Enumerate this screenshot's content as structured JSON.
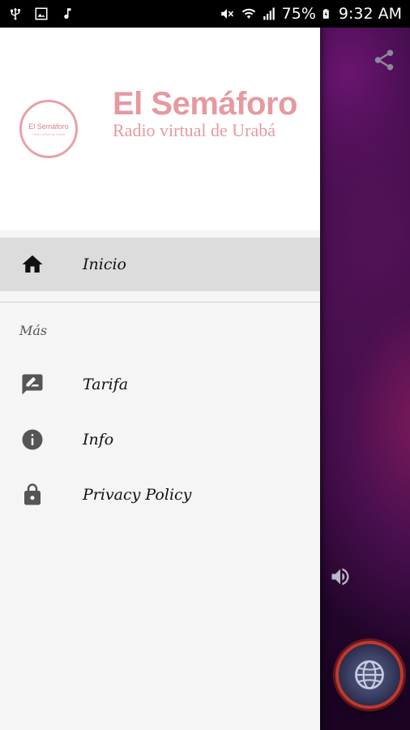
{
  "status_bar": {
    "battery": "75%",
    "time": "9:32 AM",
    "icons": [
      "usb-icon",
      "image-icon",
      "music-icon",
      "mute-icon",
      "wifi-icon",
      "signal-icon",
      "battery-icon"
    ]
  },
  "header": {
    "logo_text": "El Semáforo",
    "logo_subtext": "Radio virtual de Urabá",
    "brand_title": "El Semáforo",
    "brand_subtitle": "Radio virtual de Urabá"
  },
  "menu": {
    "primary": [
      {
        "label": "Inicio",
        "icon": "home-icon",
        "active": true
      }
    ],
    "section_title": "Más",
    "secondary": [
      {
        "label": "Tarifa",
        "icon": "rate-icon"
      },
      {
        "label": "Info",
        "icon": "info-icon"
      },
      {
        "label": "Privacy Policy",
        "icon": "lock-icon"
      }
    ]
  },
  "background_app": {
    "share_icon": "share-icon",
    "volume_icon": "volume-icon",
    "play_button_icon": "globe-icon"
  },
  "colors": {
    "brand_pink": "#e59aa0",
    "drawer_bg": "#f5f5f5",
    "active_item_bg": "#dcdcdc",
    "fab_ring": "#c0392b"
  }
}
